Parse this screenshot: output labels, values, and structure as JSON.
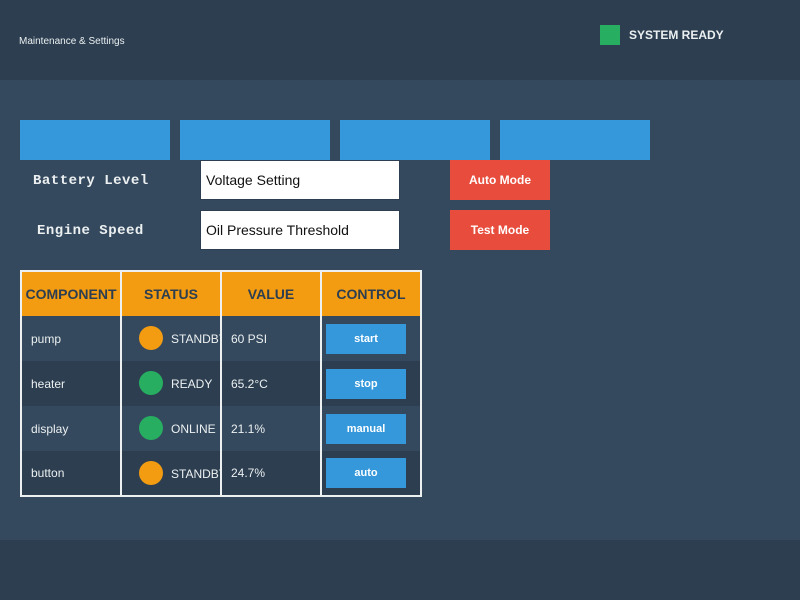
{
  "header": {
    "title": "Maintenance & Settings",
    "status_label": "SYSTEM READY",
    "status_color": "#27ae60"
  },
  "tabs": [
    {
      "label": ""
    },
    {
      "label": ""
    },
    {
      "label": ""
    },
    {
      "label": ""
    }
  ],
  "form": {
    "battery_label": "Battery Level",
    "voltage_value": "Voltage Setting",
    "engine_label": "Engine Speed",
    "oil_value": "Oil Pressure Threshold",
    "auto_mode": "Auto Mode",
    "test_mode": "Test Mode"
  },
  "table": {
    "headers": [
      "COMPONENT",
      "STATUS",
      "VALUE",
      "CONTROL"
    ],
    "rows": [
      {
        "component": "pump",
        "status": "STANDBY",
        "status_color": "#f39c12",
        "value": "60 PSI",
        "control": "start"
      },
      {
        "component": "heater",
        "status": "READY",
        "status_color": "#27ae60",
        "value": "65.2°C",
        "control": "stop"
      },
      {
        "component": "display",
        "status": "ONLINE",
        "status_color": "#27ae60",
        "value": "21.1%",
        "control": "manual"
      },
      {
        "component": "button",
        "status": "STANDBY",
        "status_color": "#f39c12",
        "value": "24.7%",
        "control": "auto"
      }
    ]
  }
}
